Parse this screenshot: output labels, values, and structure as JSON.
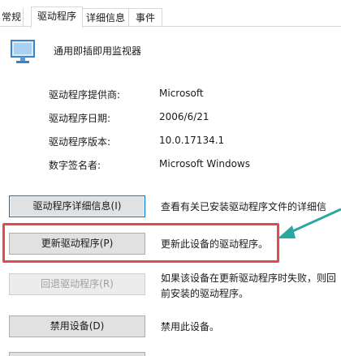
{
  "tabs": [
    {
      "label": "常规"
    },
    {
      "label": "驱动程序",
      "active": true
    },
    {
      "label": "详细信息"
    },
    {
      "label": "事件"
    }
  ],
  "device": {
    "name": "通用即插即用监视器",
    "icon": "monitor-icon"
  },
  "properties": [
    {
      "label": "驱动程序提供商:",
      "value": "Microsoft"
    },
    {
      "label": "驱动程序日期:",
      "value": "2006/6/21"
    },
    {
      "label": "驱动程序版本:",
      "value": "10.0.17134.1"
    },
    {
      "label": "数字签名者:",
      "value": "Microsoft Windows"
    }
  ],
  "actions": [
    {
      "button": "驱动程序详细信息(I)",
      "desc_line1": "查看有关已安装驱动程序文件的详细信",
      "desc_line2": ""
    },
    {
      "button": "更新驱动程序(P)",
      "desc_line1": "更新此设备的驱动程序。",
      "desc_line2": ""
    },
    {
      "button": "回退驱动程序(R)",
      "disabled": true,
      "desc_line1": "如果该设备在更新驱动程序时失败，则回",
      "desc_line2": "前安装的驱动程序。"
    },
    {
      "button": "禁用设备(D)",
      "desc_line1": "禁用此设备。",
      "desc_line2": ""
    }
  ],
  "colors": {
    "highlight": "#e34a4f",
    "arrow": "#2aa8a0",
    "focus": "#0078d7"
  }
}
